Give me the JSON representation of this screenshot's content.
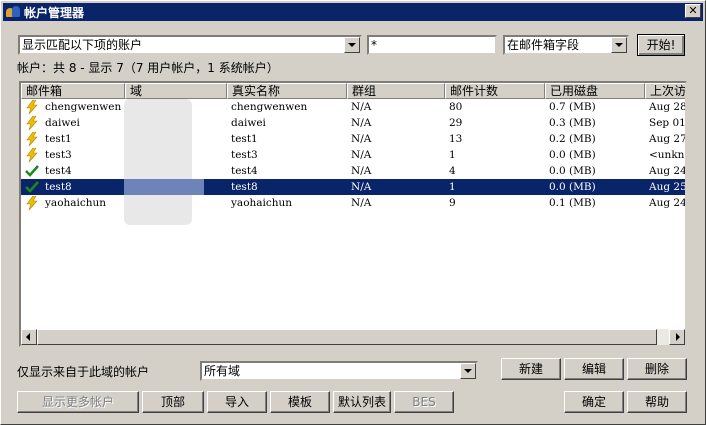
{
  "window": {
    "title": "帐户管理器",
    "close_glyph": "✕"
  },
  "filter": {
    "mode_value": "显示匹配以下项的账户",
    "pattern_value": "*",
    "field_value": "在邮件箱字段",
    "start_label": "开始!"
  },
  "summary": "帐户：共 8 - 显示 7（7 用户帐户，1 系统帐户）",
  "table": {
    "headers": [
      "邮件箱",
      "域",
      "真实名称",
      "群组",
      "邮件计数",
      "已用磁盘",
      "上次访"
    ],
    "rows": [
      {
        "mailbox": "chengwenwen",
        "realname": "chengwenwen",
        "group": "N/A",
        "count": "80",
        "disk": "0.7 (MB)",
        "last": "Aug 28",
        "icon": "lightning-icon"
      },
      {
        "mailbox": "daiwei",
        "realname": "daiwei",
        "group": "N/A",
        "count": "29",
        "disk": "0.3 (MB)",
        "last": "Sep 01",
        "icon": "lightning-icon"
      },
      {
        "mailbox": "test1",
        "realname": "test1",
        "group": "N/A",
        "count": "13",
        "disk": "0.2 (MB)",
        "last": "Aug 27",
        "icon": "lightning-icon"
      },
      {
        "mailbox": "test3",
        "realname": "test3",
        "group": "N/A",
        "count": "1",
        "disk": "0.0 (MB)",
        "last": "<unkno",
        "icon": "lightning-icon"
      },
      {
        "mailbox": "test4",
        "realname": "test4",
        "group": "N/A",
        "count": "4",
        "disk": "0.0 (MB)",
        "last": "Aug 24",
        "icon": "checkmark-icon"
      },
      {
        "mailbox": "test8",
        "realname": "test8",
        "group": "N/A",
        "count": "1",
        "disk": "0.0 (MB)",
        "last": "Aug 25",
        "icon": "checkmark-icon"
      },
      {
        "mailbox": "yaohaichun",
        "realname": "yaohaichun",
        "group": "N/A",
        "count": "9",
        "disk": "0.1 (MB)",
        "last": "Aug 24",
        "icon": "lightning-icon"
      }
    ],
    "selected_index": 5
  },
  "domain_filter": {
    "label": "仅显示来自于此域的帐户",
    "value": "所有域"
  },
  "buttons": {
    "new": "新建",
    "edit": "编辑",
    "delete": "删除",
    "show_more": "显示更多帐户",
    "top": "顶部",
    "import": "导入",
    "template": "模板",
    "default_list": "默认列表",
    "bes": "BES",
    "ok": "确定",
    "help": "帮助"
  },
  "colors": {
    "selection": "#0a246a",
    "titlebar": "#0a246a",
    "face": "#d4d0c8"
  }
}
